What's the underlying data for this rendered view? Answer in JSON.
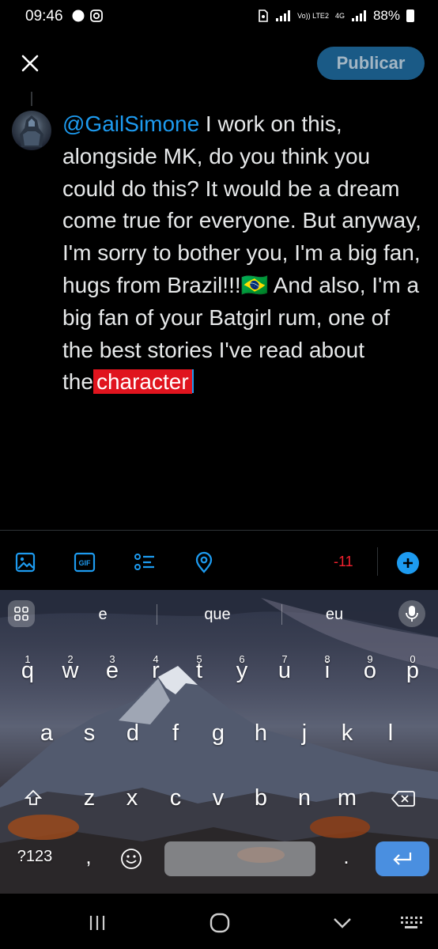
{
  "status_bar": {
    "time": "09:46",
    "network_label": "Vo)) LTE2",
    "network_type": "4G",
    "battery": "88%"
  },
  "header": {
    "publish_label": "Publicar"
  },
  "tweet": {
    "mention": "@GailSimone",
    "body": " I work on this, alongside MK, do you think you could do this? It would be a dream come true for everyone. But anyway, I'm sorry to bother you, I'm a big fan, hugs from Brazil!!!🇧🇷 And also, I'm a big fan of your Batgirl rum, one of the best stories I've read about the",
    "overflow": "character"
  },
  "toolbar": {
    "icons": [
      "image-icon",
      "gif-icon",
      "poll-icon",
      "location-icon"
    ],
    "gif_label": "GIF",
    "char_counter": "-11"
  },
  "keyboard": {
    "suggestions": [
      "e",
      "que",
      "eu"
    ],
    "row1": [
      {
        "key": "q",
        "num": "1"
      },
      {
        "key": "w",
        "num": "2"
      },
      {
        "key": "e",
        "num": "3"
      },
      {
        "key": "r",
        "num": "4"
      },
      {
        "key": "t",
        "num": "5"
      },
      {
        "key": "y",
        "num": "6"
      },
      {
        "key": "u",
        "num": "7"
      },
      {
        "key": "i",
        "num": "8"
      },
      {
        "key": "o",
        "num": "9"
      },
      {
        "key": "p",
        "num": "0"
      }
    ],
    "row2": [
      "a",
      "s",
      "d",
      "f",
      "g",
      "h",
      "j",
      "k",
      "l"
    ],
    "row3": [
      "z",
      "x",
      "c",
      "v",
      "b",
      "n",
      "m"
    ],
    "symbols_label": "?123",
    "comma": ",",
    "period": "."
  },
  "colors": {
    "accent": "#1d9bf0",
    "over_limit": "#e0141e",
    "publish_bg": "#1a5a86",
    "enter_key": "#4a8fe0"
  }
}
